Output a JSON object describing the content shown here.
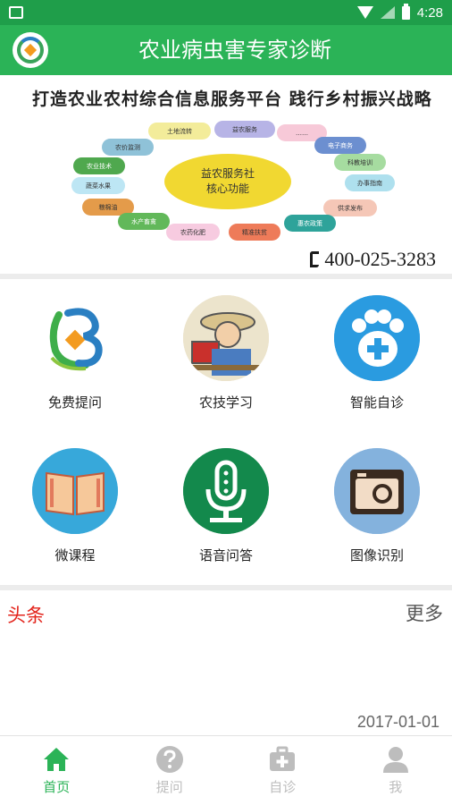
{
  "status_bar": {
    "time": "4:28"
  },
  "app_bar": {
    "title": "农业病虫害专家诊断"
  },
  "banner": {
    "slogan": "打造农业农村综合信息服务平台 践行乡村振兴战略",
    "core_line1": "益农服务社",
    "core_line2": "核心功能",
    "services": [
      "土地流转",
      "益农服务",
      "……",
      "电子商务",
      "农价监测",
      "科教培训",
      "农业技术",
      "办事指南",
      "蔬菜水果",
      "供求发布",
      "粮棉油",
      "水产畜禽",
      "农药化肥",
      "精准扶贫",
      "惠农政策"
    ],
    "phone": "400-025-3283"
  },
  "grid": {
    "items": [
      {
        "label": "免费提问",
        "icon": "app-logo-icon"
      },
      {
        "label": "农技学习",
        "icon": "farmer-icon"
      },
      {
        "label": "智能自诊",
        "icon": "paw-plus-icon"
      },
      {
        "label": "微课程",
        "icon": "book-icon"
      },
      {
        "label": "语音问答",
        "icon": "microphone-icon"
      },
      {
        "label": "图像识别",
        "icon": "camera-icon"
      }
    ]
  },
  "news": {
    "title": "头条",
    "more": "更多",
    "date": "2017-01-01"
  },
  "tabs": [
    {
      "label": "首页",
      "icon": "home-icon",
      "active": true
    },
    {
      "label": "提问",
      "icon": "question-icon",
      "active": false
    },
    {
      "label": "自诊",
      "icon": "medkit-icon",
      "active": false
    },
    {
      "label": "我",
      "icon": "person-icon",
      "active": false
    }
  ],
  "colors": {
    "primary": "#2bb357",
    "status_bar": "#1f9e4a",
    "news_title": "#e3241c"
  }
}
